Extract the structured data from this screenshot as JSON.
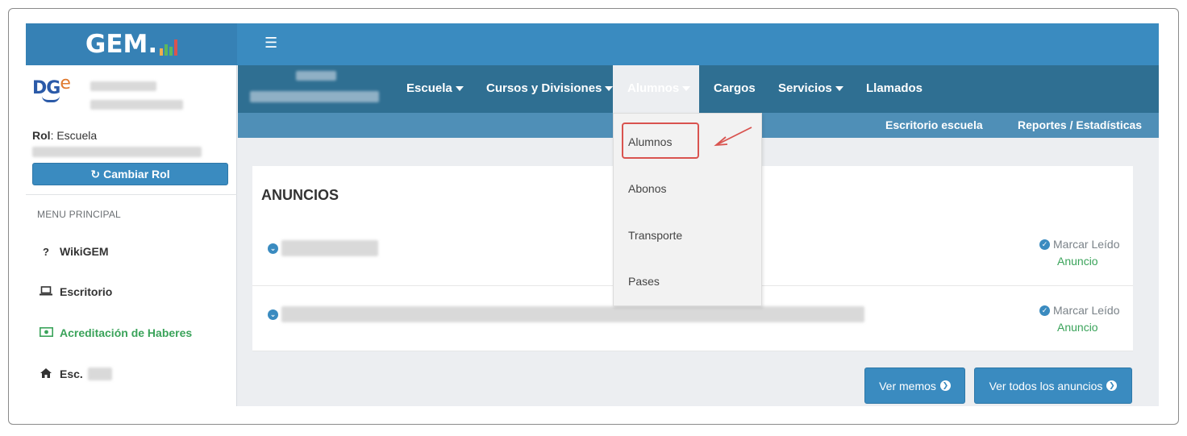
{
  "app": {
    "logo_text": "GEM.",
    "logo_bar_colors": [
      "#f0ad4e",
      "#5cb85c",
      "#5cb85c",
      "#d9534f"
    ],
    "menu_icon": "hamburger-icon"
  },
  "sidebar": {
    "dge_logo": "DGE",
    "rol_label": "Rol",
    "rol_value": ": Escuela",
    "cambiar_rol_label": "Cambiar Rol",
    "menu_title": "MENU PRINCIPAL",
    "items": [
      {
        "label": "WikiGEM",
        "icon": "question-icon"
      },
      {
        "label": "Escritorio",
        "icon": "laptop-icon"
      },
      {
        "label": "Acreditación de Haberes",
        "icon": "money-icon",
        "color": "#3aa35a"
      },
      {
        "label": "Esc.",
        "icon": "home-icon"
      }
    ]
  },
  "navbar": {
    "items": [
      {
        "label": "Escuela",
        "has_caret": true
      },
      {
        "label": "Cursos y Divisiones",
        "has_caret": true
      },
      {
        "label": "Alumnos",
        "has_caret": true,
        "active": true
      },
      {
        "label": "Cargos",
        "has_caret": false
      },
      {
        "label": "Servicios",
        "has_caret": true
      },
      {
        "label": "Llamados",
        "has_caret": false
      }
    ],
    "sub_links": [
      "Escritorio escuela",
      "Reportes / Estadísticas"
    ]
  },
  "dropdown": {
    "items": [
      "Alumnos",
      "Abonos",
      "Transporte",
      "Pases"
    ],
    "highlighted": "Alumnos",
    "highlight_color": "#d9534f"
  },
  "card": {
    "title": "ANUNCIOS",
    "rows": [
      {
        "action_label": "Marcar Leído",
        "type_label": "Anuncio"
      },
      {
        "action_label": "Marcar Leído",
        "type_label": "Anuncio"
      }
    ]
  },
  "buttons": {
    "ver_memos": "Ver memos",
    "ver_todos": "Ver todos los anuncios"
  },
  "colors": {
    "primary": "#3a8bc0",
    "navbar": "#2f6f92",
    "subbar": "#4f8fb7",
    "success": "#3aa35a"
  }
}
